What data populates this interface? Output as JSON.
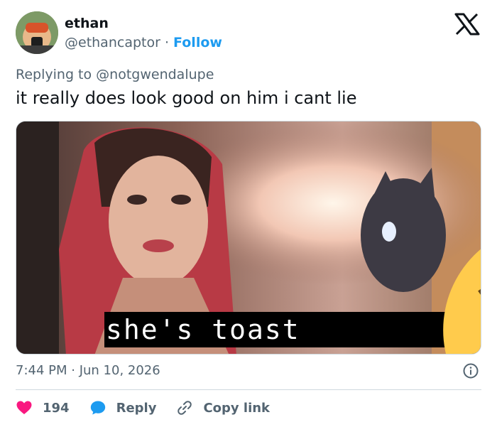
{
  "author": {
    "name": "ethan",
    "handle": "@ethancaptor",
    "separator": "·",
    "follow_label": "Follow"
  },
  "reply_context": {
    "prefix": "Replying to",
    "target": "@notgwendalupe"
  },
  "tweet": {
    "text": "it really does look good on him i cant lie"
  },
  "media": {
    "caption": "she's toast",
    "caption_emoji_icons": [
      "loudly-crying-face-icon",
      "loudly-crying-face-icon",
      "loudly-crying-face-icon"
    ]
  },
  "meta": {
    "timestamp": "7:44 PM · Jun 10, 2026"
  },
  "actions": {
    "likes_count": "194",
    "reply_label": "Reply",
    "copy_link_label": "Copy link"
  },
  "colors": {
    "accent": "#1d9bf0",
    "like_red": "#f91880",
    "secondary_text": "#536471",
    "primary_text": "#0f1419"
  }
}
